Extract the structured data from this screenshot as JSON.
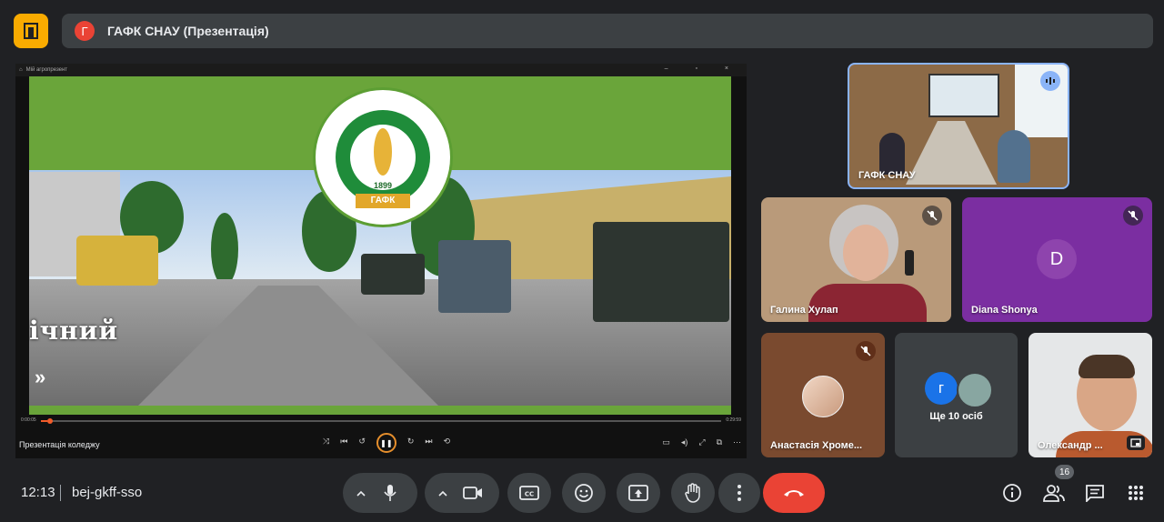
{
  "app_icon": "meet-room-icon",
  "header": {
    "avatar_letter": "Г",
    "title": "ГАФК СНАУ (Презентація)"
  },
  "presentation": {
    "window_title": "Мій агропрезент",
    "logo_year": "1899",
    "logo_ribbon": "ГАФК",
    "slide_text": "ічний",
    "slide_arrows": "»",
    "time_current": "0:00:05",
    "time_total": "0:29:59",
    "progress": 0.01,
    "caption": "Презентація коледжу",
    "accent_color": "#6aa53a"
  },
  "participants": [
    {
      "name": "ГАФК СНАУ",
      "state": "speaking"
    },
    {
      "name": "Галина Хулап",
      "state": "muted"
    },
    {
      "name": "Diana Shonya",
      "avatar_letter": "D",
      "state": "muted"
    },
    {
      "name": "Анастасія Хроме...",
      "state": "muted"
    },
    {
      "name": "Олександр ...",
      "state": "pinned"
    }
  ],
  "more_tile": {
    "avatar_letter": "г",
    "label": "Ще 10 осіб"
  },
  "bottom_bar": {
    "time": "12:13",
    "meeting_code": "bej-gkff-sso",
    "participants_count": "16",
    "end_call_color": "#ea4335"
  }
}
